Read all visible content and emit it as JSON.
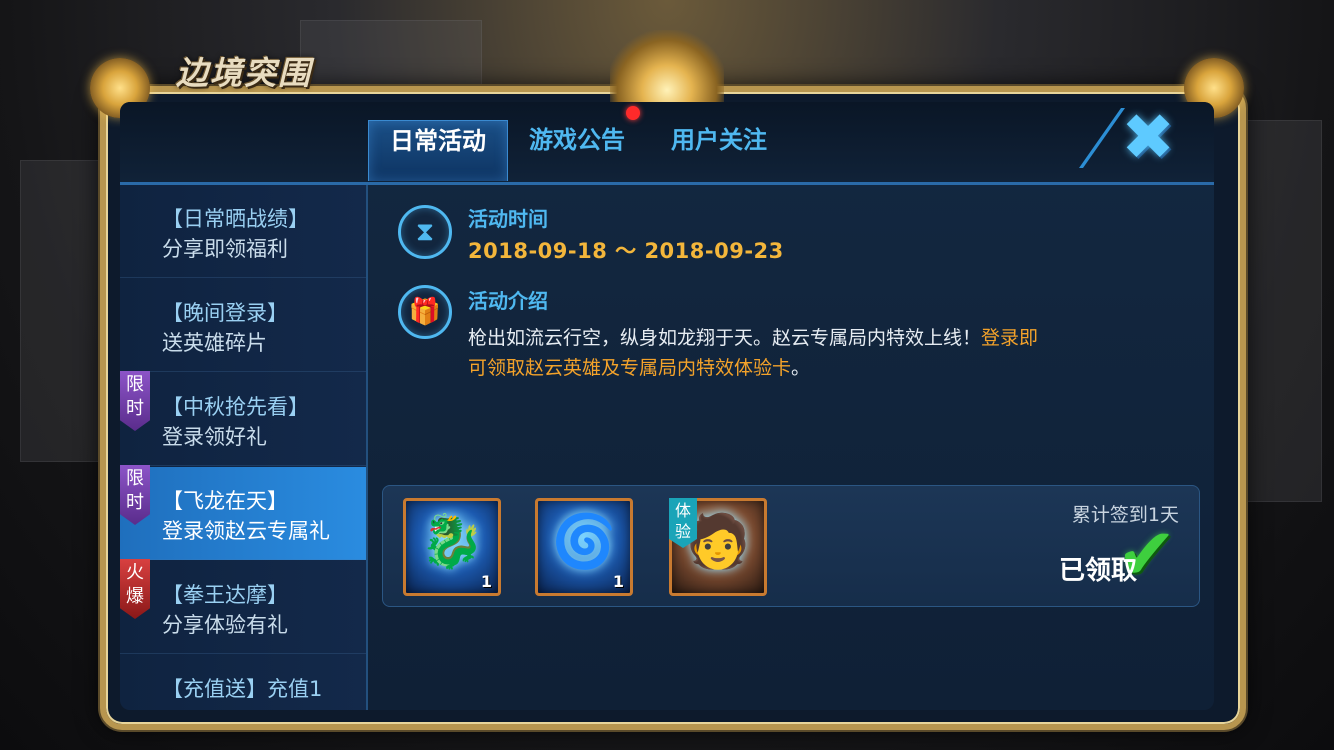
{
  "game_title": "边境突围",
  "tabs": [
    {
      "label": "日常活动",
      "active": true
    },
    {
      "label": "游戏公告",
      "active": false
    },
    {
      "label": "用户关注",
      "active": false
    }
  ],
  "close_icon": "close-x-icon",
  "sidebar": {
    "items": [
      {
        "line1": "【日常晒战绩】",
        "line2": "分享即领福利",
        "badge": "",
        "active": false
      },
      {
        "line1": "【晚间登录】",
        "line2": "送英雄碎片",
        "badge": "",
        "active": false
      },
      {
        "line1": "【中秋抢先看】",
        "line2": "登录领好礼",
        "badge": "限时",
        "active": false
      },
      {
        "line1": "【飞龙在天】",
        "line2": "登录领赵云专属礼",
        "badge": "限时",
        "active": true
      },
      {
        "line1": "【拳王达摩】",
        "line2": "分享体验有礼",
        "badge": "火爆",
        "active": false
      },
      {
        "line1": "【充值送】充值1",
        "line2": "",
        "badge": "",
        "active": false
      }
    ]
  },
  "activity": {
    "time_title": "活动时间",
    "time_range": "2018-09-18 ～ 2018-09-23",
    "intro_title": "活动介绍",
    "intro_text": "枪出如流云行空，纵身如龙翔于天。赵云专属局内特效上线！",
    "intro_highlight_1": "登录即",
    "intro_highlight_2": "可领取赵云英雄及专属局内特效体验卡",
    "intro_end": "。"
  },
  "rewards": {
    "items": [
      {
        "count": "1",
        "tag": ""
      },
      {
        "count": "1",
        "tag": ""
      },
      {
        "count": "",
        "tag": "体验"
      }
    ],
    "sign_text": "累计签到1天",
    "claimed_text": "已领取"
  },
  "colors": {
    "accent_blue": "#4fb8f0",
    "date_orange": "#f3b63b",
    "highlight_orange": "#f3a22a",
    "active_tab": "#1a4f86"
  }
}
